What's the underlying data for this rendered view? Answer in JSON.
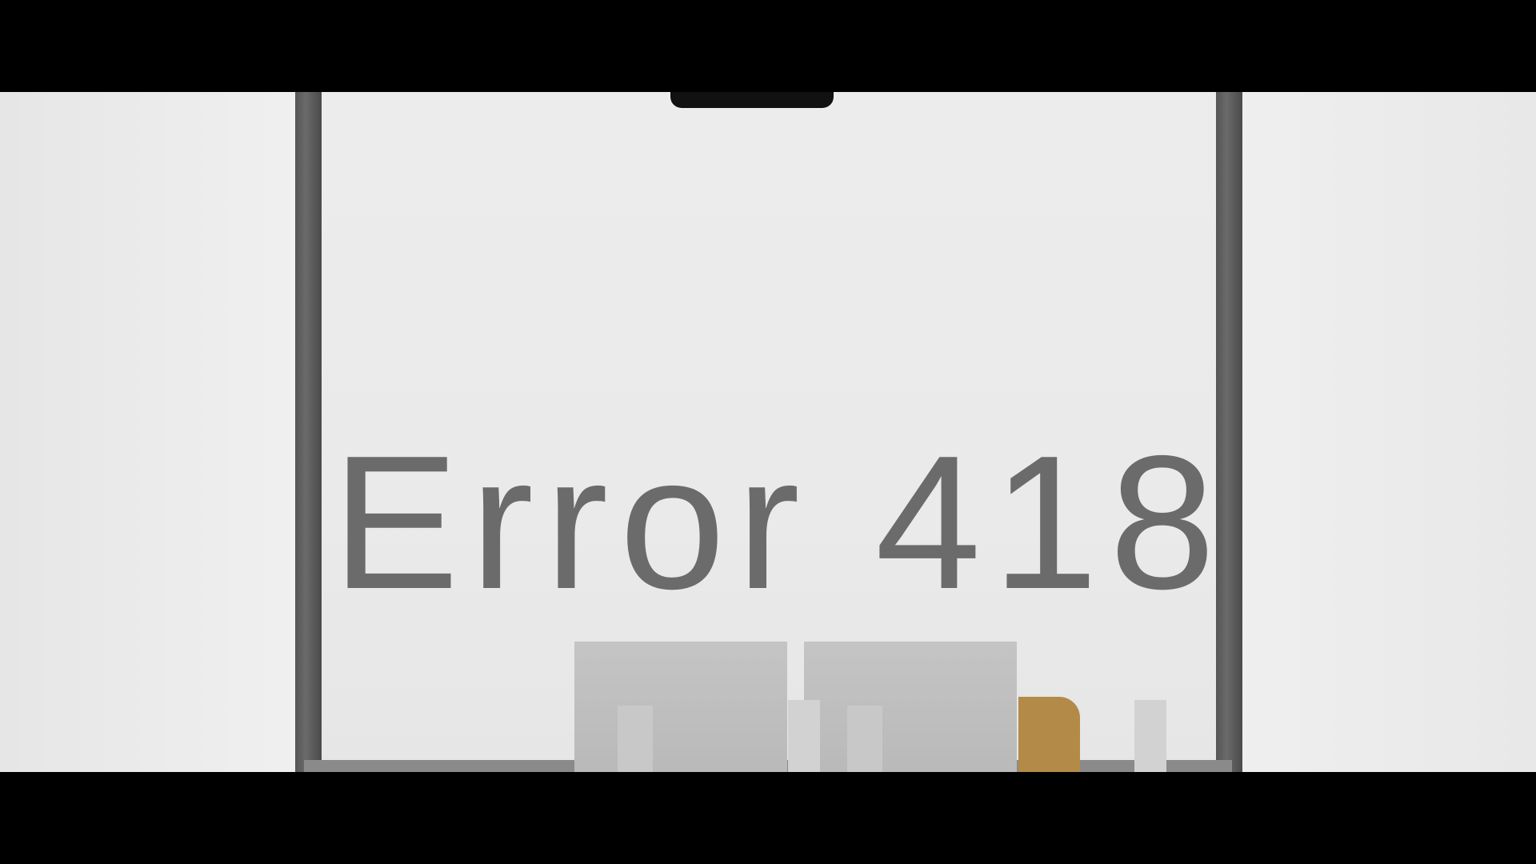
{
  "scene": {
    "wall_text": "Error 418",
    "colors": {
      "text": "#6b6b6b",
      "chair": "#b38a48",
      "frame": "#555555"
    }
  }
}
